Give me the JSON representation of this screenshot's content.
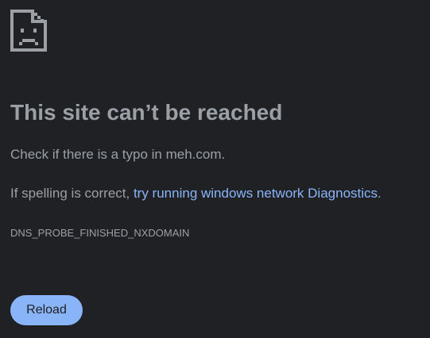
{
  "page": {
    "background": "#202124",
    "icon": "sad-page-icon"
  },
  "error": {
    "title": "This site can’t be reached",
    "typo_message": "Check if there is a typo in meh.com.",
    "spelling_prefix": "If spelling is correct, ",
    "diagnostics_link": "try running windows network Diagnostics",
    "spelling_suffix": ".",
    "code": "DNS_PROBE_FINISHED_NXDOMAIN"
  },
  "actions": {
    "reload_label": "Reload"
  },
  "colors": {
    "text": "#9aa0a6",
    "link": "#8ab4f8",
    "button_bg": "#8ab4f8",
    "button_text": "#202124"
  }
}
